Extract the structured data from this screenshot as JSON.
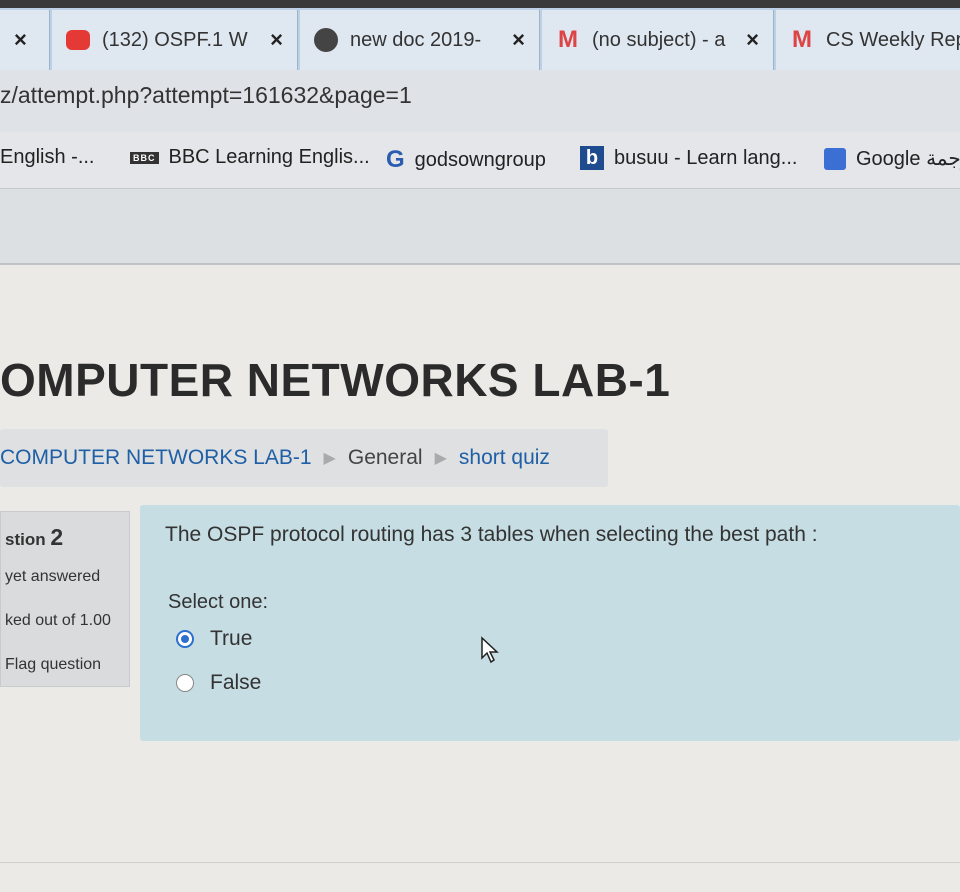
{
  "browser": {
    "tabs": [
      {
        "title": "",
        "icon": "close-icon"
      },
      {
        "title": "(132) OSPF.1 W",
        "icon": "youtube-icon"
      },
      {
        "title": "new doc 2019-",
        "icon": "globe-icon"
      },
      {
        "title": "(no subject) - a",
        "icon": "gmail-icon"
      },
      {
        "title": "CS Weekly Rep",
        "icon": "gmail-icon"
      }
    ],
    "close_glyph": "×",
    "url": "z/attempt.php?attempt=161632&page=1",
    "bookmarks": [
      {
        "label": "English -...",
        "icon": ""
      },
      {
        "label": "BBC Learning Englis...",
        "icon": "bbc-icon",
        "badge": "BBC"
      },
      {
        "label": "godsowngroup",
        "icon": "g-icon",
        "badge": "G"
      },
      {
        "label": "busuu - Learn lang...",
        "icon": "busuu-icon",
        "badge": "b"
      },
      {
        "label": "Google ترجمة",
        "icon": "google-translate-icon"
      }
    ]
  },
  "page": {
    "heading": "OMPUTER NETWORKS LAB-1",
    "breadcrumb": [
      "COMPUTER NETWORKS LAB-1",
      "General",
      "short quiz"
    ],
    "breadcrumb_sep": "▶",
    "question_info": {
      "label": "stion",
      "number": "2",
      "status": "yet answered",
      "marked": "ked out of 1.00",
      "flag": "Flag question"
    },
    "question": {
      "text": "The OSPF protocol  routing  has  3  tables when selecting the best path :",
      "prompt": "Select one:",
      "options": [
        {
          "label": "True",
          "selected": true
        },
        {
          "label": "False",
          "selected": false
        }
      ]
    }
  },
  "colors": {
    "link": "#1e5fa6",
    "question_bg": "#c5dde3",
    "radio_selected": "#2d6fd0"
  }
}
